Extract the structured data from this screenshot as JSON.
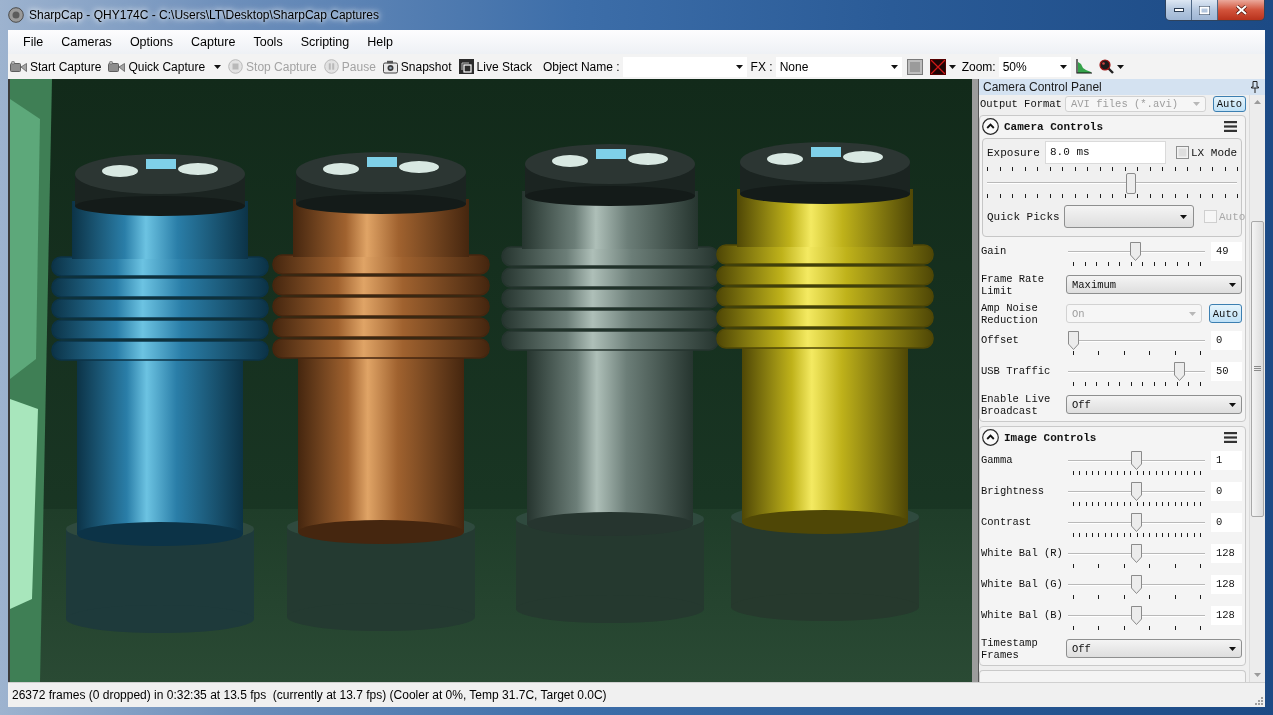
{
  "window": {
    "title": "SharpCap - QHY174C - C:\\Users\\LT\\Desktop\\SharpCap Captures"
  },
  "menu": [
    {
      "label": "File"
    },
    {
      "label": "Cameras"
    },
    {
      "label": "Options"
    },
    {
      "label": "Capture"
    },
    {
      "label": "Tools"
    },
    {
      "label": "Scripting"
    },
    {
      "label": "Help"
    }
  ],
  "toolbar": {
    "buttons": [
      {
        "label": "Start Capture",
        "kind": "camera",
        "disabled": false,
        "dropdown": false
      },
      {
        "label": "Quick Capture",
        "kind": "camera",
        "disabled": false,
        "dropdown": true
      },
      {
        "label": "Stop Capture",
        "kind": "stop",
        "disabled": true,
        "dropdown": false
      },
      {
        "label": "Pause",
        "kind": "pause",
        "disabled": true,
        "dropdown": false
      },
      {
        "label": "Snapshot",
        "kind": "snapshot",
        "disabled": false,
        "dropdown": false
      },
      {
        "label": "Live Stack",
        "kind": "stack",
        "disabled": false,
        "dropdown": false
      }
    ],
    "object_name": {
      "label": "Object Name :"
    },
    "fx": {
      "label": "FX :",
      "value": "None"
    },
    "zoom": {
      "label": "Zoom:",
      "value": "50%"
    }
  },
  "panel": {
    "title": "Camera Control Panel",
    "output_format": {
      "label": "Output Format",
      "value": "AVI files (*.avi)",
      "auto": {
        "label": "Auto",
        "on": true
      }
    },
    "groups": [
      {
        "title": "Camera Controls",
        "expanded": true,
        "exposure": {
          "label": "Exposure",
          "value": "8.0 ms",
          "lx_mode": {
            "label": "LX Mode",
            "checked": false
          },
          "level": 0.58,
          "quick_picks": {
            "label": "Quick Picks",
            "auto": {
              "label": "Auto",
              "checked": false,
              "disabled": true
            }
          }
        },
        "rows": [
          {
            "kind": "slider",
            "label": "Gain",
            "level": 0.49,
            "value": "49",
            "scale": {
              "kind": "medium"
            }
          },
          {
            "kind": "dropdown",
            "label": "Frame Rate Limit",
            "value": "Maximum",
            "disabled": false
          },
          {
            "kind": "dropdown",
            "label": "Amp Noise Reduction",
            "value": "On",
            "disabled": true,
            "auto": {
              "label": "Auto",
              "on": true
            }
          },
          {
            "kind": "slider",
            "label": "Offset",
            "level": 0,
            "value": "0",
            "scale": {
              "kind": "sparse"
            }
          },
          {
            "kind": "slider",
            "label": "USB Traffic",
            "level": 0.84,
            "value": "50",
            "scale": {
              "kind": "medium"
            }
          },
          {
            "kind": "dropdown",
            "label": "Enable Live Broadcast",
            "value": "Off",
            "disabled": false
          }
        ]
      },
      {
        "title": "Image Controls",
        "expanded": true,
        "rows": [
          {
            "kind": "slider",
            "label": "Gamma",
            "level": 0.5,
            "value": "1",
            "scale": {
              "kind": "dense"
            }
          },
          {
            "kind": "slider",
            "label": "Brightness",
            "level": 0.5,
            "value": "0",
            "scale": {
              "kind": "dense"
            }
          },
          {
            "kind": "slider",
            "label": "Contrast",
            "level": 0.5,
            "value": "0",
            "scale": {
              "kind": "dense"
            }
          },
          {
            "kind": "slider",
            "label": "White Bal (R)",
            "level": 0.5,
            "value": "128",
            "scale": {
              "kind": "sparse"
            }
          },
          {
            "kind": "slider",
            "label": "White Bal (G)",
            "level": 0.5,
            "value": "128",
            "scale": {
              "kind": "sparse"
            }
          },
          {
            "kind": "slider",
            "label": "White Bal (B)",
            "level": 0.5,
            "value": "128",
            "scale": {
              "kind": "sparse"
            }
          },
          {
            "kind": "dropdown",
            "label": "Timestamp Frames",
            "value": "Off",
            "disabled": false
          }
        ]
      }
    ]
  },
  "status_bar": {
    "text": "26372 frames (0 dropped) in 0:32:35 at 13.5 fps  (currently at 13.7 fps) (Cooler at 0%, Temp 31.7C, Target 0.0C)"
  }
}
